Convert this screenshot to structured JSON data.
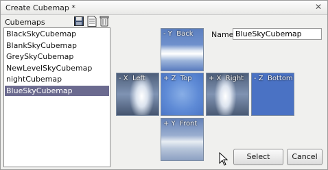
{
  "window": {
    "title": "Create Cubemap *"
  },
  "icons": {
    "close": "close-icon",
    "save": "save-icon",
    "new": "new-document-icon",
    "delete": "delete-icon"
  },
  "list": {
    "label": "Cubemaps",
    "items": [
      "BlackSkyCubemap",
      "BlankSkyCubemap",
      "GreySkyCubemap",
      "NewLevelSkyCubemap",
      "nightCubemap",
      "BlueSkyCubemap"
    ],
    "selected_index": 5
  },
  "faces": {
    "back": "- Y  Back",
    "left": "- X  Left",
    "top": "+ Z  Top",
    "right": "+ X  Right",
    "bottom": "- Z  Bottom",
    "front": "+ Y  Front"
  },
  "name": {
    "label": "Name",
    "value": "BlueSkyCubemap"
  },
  "buttons": {
    "select": "Select",
    "cancel": "Cancel"
  },
  "colors": {
    "selection": "#6b6a8f",
    "sky": "#4a72c4"
  }
}
